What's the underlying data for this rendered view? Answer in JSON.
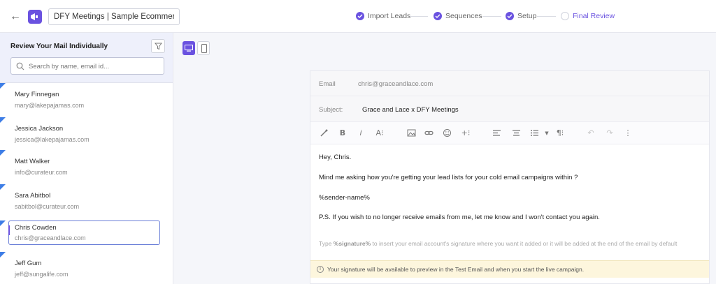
{
  "header": {
    "campaign_name": "DFY Meetings | Sample Ecommerce from S",
    "steps": [
      {
        "label": "Import Leads",
        "done": true
      },
      {
        "label": "Sequences",
        "done": true
      },
      {
        "label": "Setup",
        "done": true
      },
      {
        "label": "Final Review",
        "done": false
      }
    ]
  },
  "sidebar": {
    "title": "Review Your Mail Individually",
    "search_placeholder": "Search by name, email id...",
    "contacts": [
      {
        "name": "Mary Finnegan",
        "email": "mary@lakepajamas.com"
      },
      {
        "name": "Jessica Jackson",
        "email": "jessica@lakepajamas.com"
      },
      {
        "name": "Matt Walker",
        "email": "info@curateur.com"
      },
      {
        "name": "Sara Abitbol",
        "email": "sabitbol@curateur.com"
      },
      {
        "name": "Chris Cowden",
        "email": "chris@graceandlace.com"
      },
      {
        "name": "Jeff Gum",
        "email": "jeff@sungalife.com"
      }
    ]
  },
  "editor": {
    "email_label": "Email",
    "email_value": "chris@graceandlace.com",
    "subject_label": "Subject:",
    "subject_value": "Grace and Lace x DFY Meetings",
    "body": [
      "Hey, Chris.",
      "Mind me asking how you're getting your lead lists for your cold email campaigns within ?",
      "%sender-name%",
      "P.S. If you wish to no longer receive emails from me, let me know and I won't contact you again."
    ],
    "hint_prefix": "Type ",
    "hint_token": "%signature%",
    "hint_suffix": " to insert your email account's signature where you want it added or it will be added at the end of the email by default",
    "notice": "Your signature will be available to preview in the Test Email and when you start the live campaign."
  },
  "colors": {
    "accent": "#6a52e0",
    "flag": "#3d7de6",
    "notice_bg": "#fdf6dd"
  }
}
